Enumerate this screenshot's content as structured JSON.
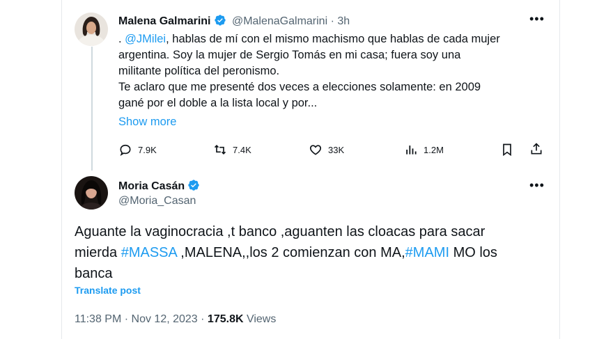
{
  "reply": {
    "author_name": "Malena Galmarini",
    "author_handle": "@MalenaGalmarini",
    "time_ago": "· 3h",
    "mention": "@JMilei",
    "text_after_mention": ", hablas de mí con el mismo machismo que hablas de cada mujer",
    "line2": "argentina. Soy la mujer de Sergio Tomás en mi casa; fuera soy una",
    "line3": "militante política del peronismo.",
    "line4": "Te aclaro que me presenté dos veces a elecciones solamente: en 2009",
    "line5": "gané por el doble a la lista local y por...",
    "show_more": "Show more",
    "replies": "7.9K",
    "reposts": "7.4K",
    "likes": "33K",
    "views": "1.2M"
  },
  "main_post": {
    "author_name": "Moria Casán",
    "author_handle": "@Moria_Casan",
    "line1": "Aguante la vaginocracia ,t banco ,aguanten las cloacas para sacar",
    "line2_a": "mierda ",
    "hashtag1": "#MASSA",
    "line2_b": " ,MALENA,,los 2 comienzan con MA,",
    "hashtag2": "#MAMI",
    "line2_c": " MO los",
    "line3": "banca",
    "translate": "Translate post",
    "timestamp": "11:38 PM · Nov 12, 2023 · ",
    "view_count": "175.8K",
    "views_label": " Views"
  },
  "colors": {
    "accent": "#1d9bf0",
    "secondary_text": "#536471",
    "primary_text": "#0f1419"
  },
  "icons": [
    "verified-badge-icon",
    "more-icon",
    "reply-icon",
    "repost-icon",
    "like-icon",
    "views-icon",
    "bookmark-icon",
    "share-icon"
  ]
}
